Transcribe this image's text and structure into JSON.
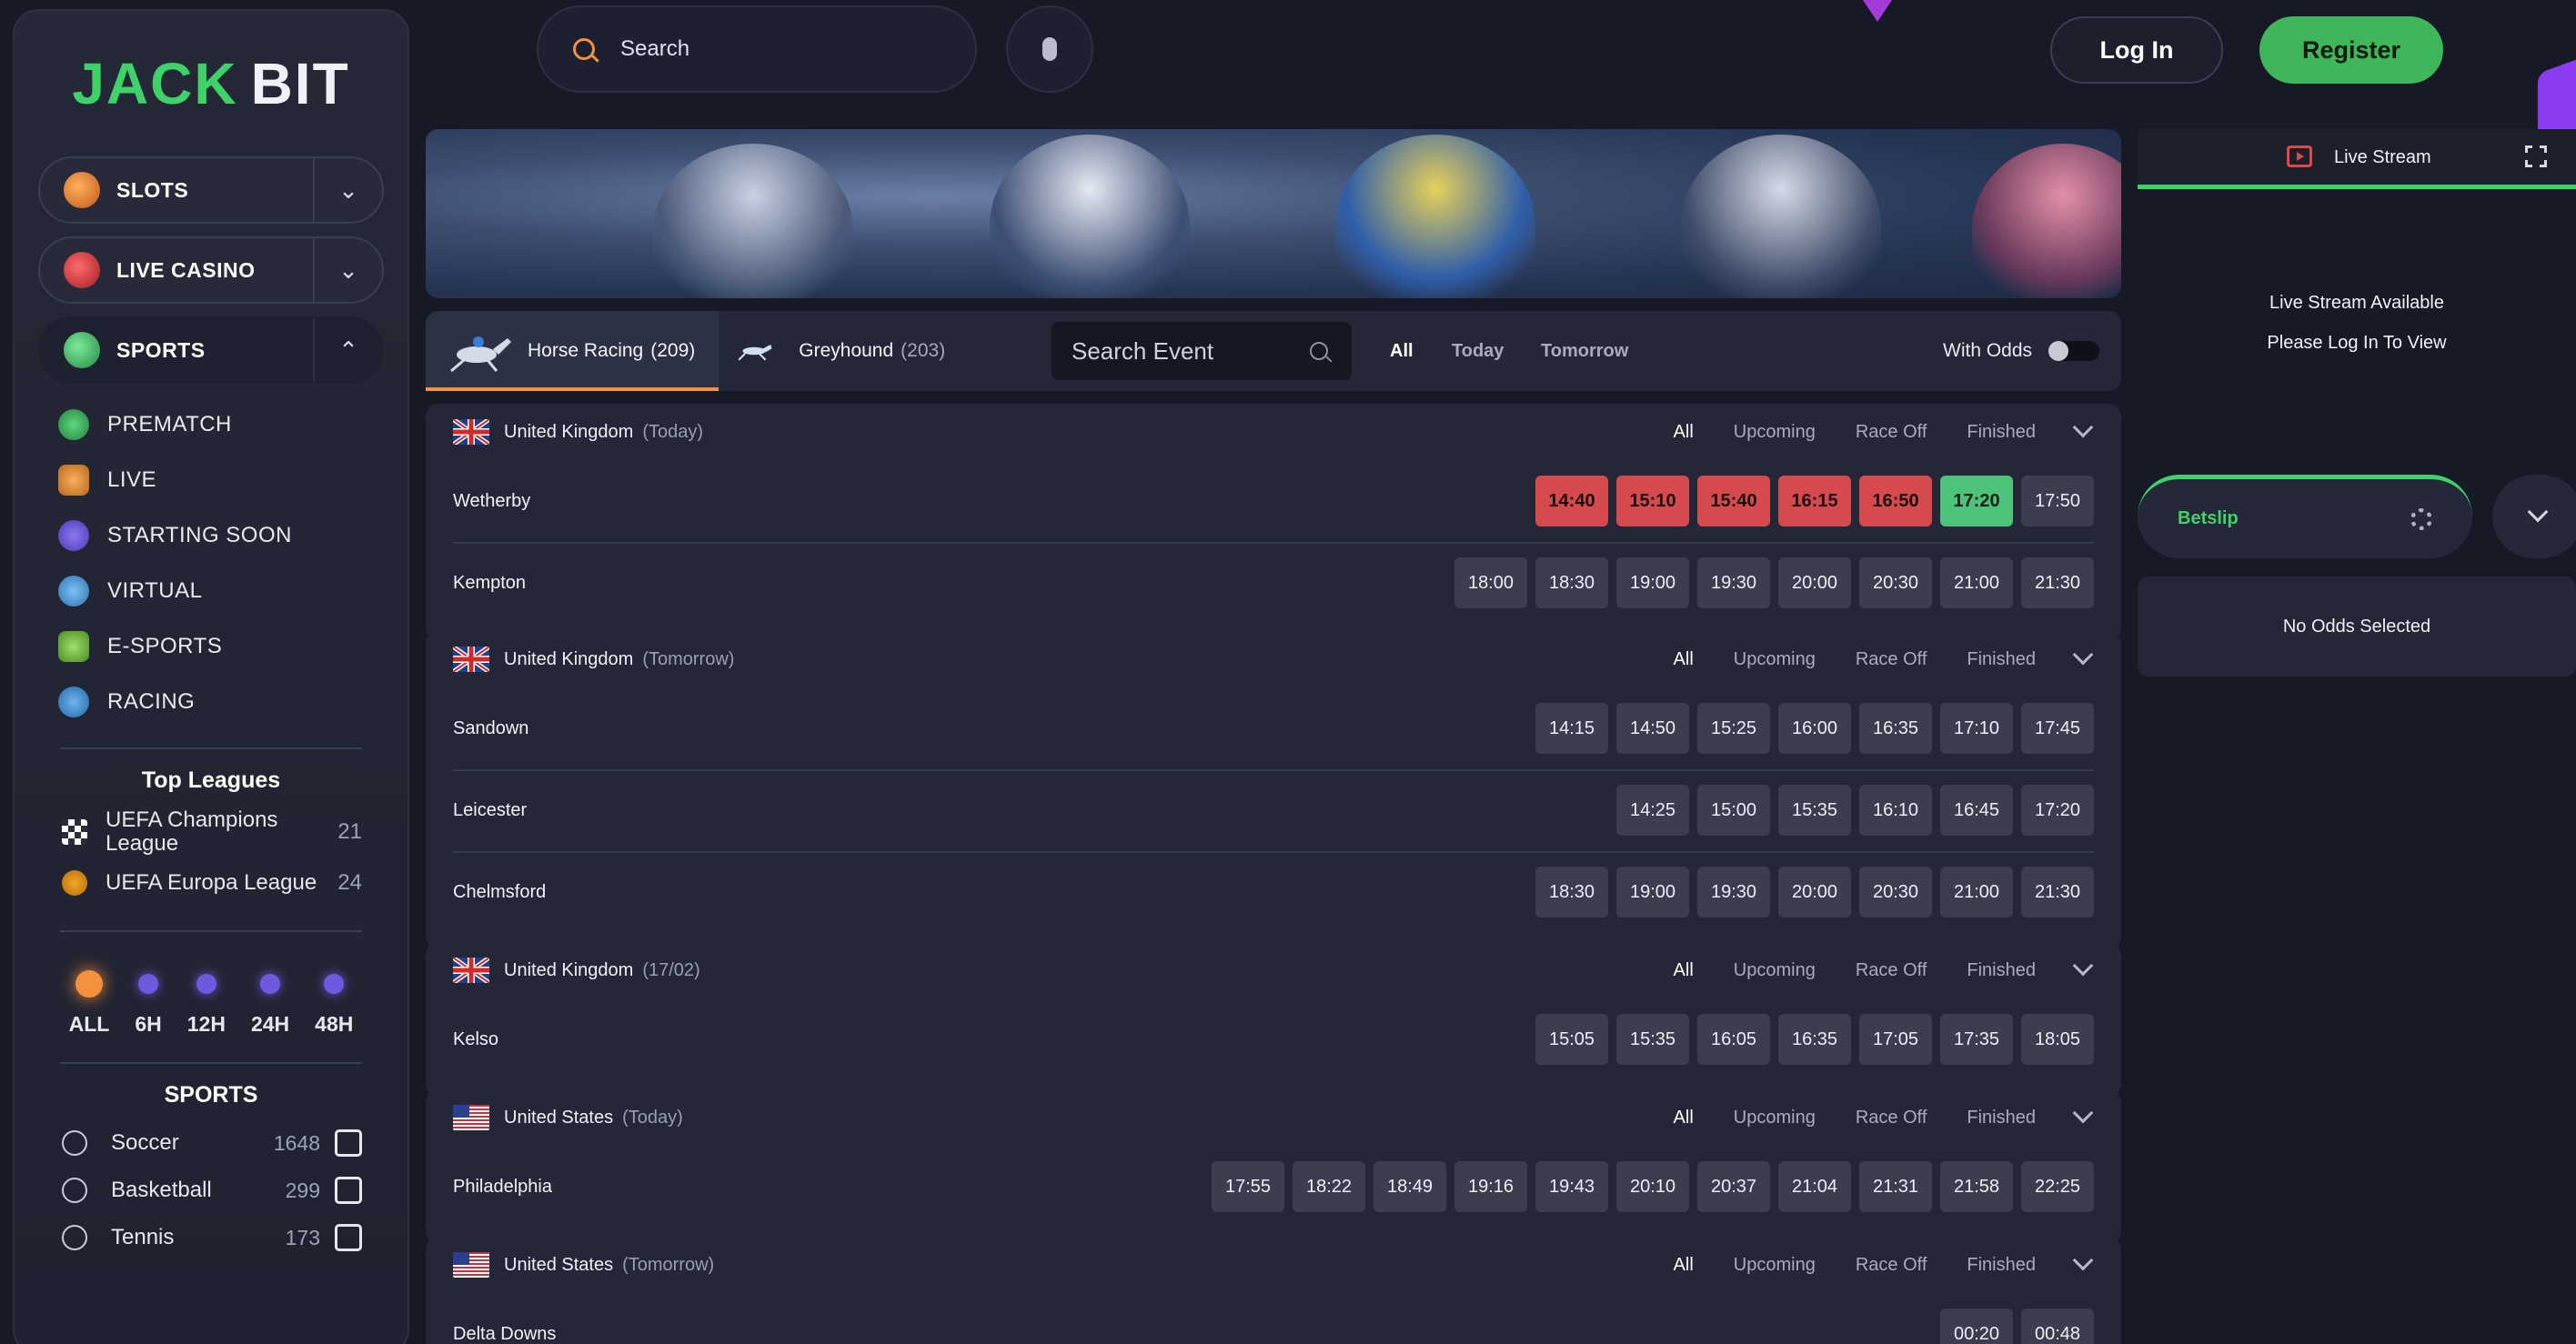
{
  "brand": {
    "part1": "JACK",
    "part2": "BIT"
  },
  "sidebar": {
    "menus": [
      {
        "label": "SLOTS",
        "icon": "slots-icon",
        "expanded": false
      },
      {
        "label": "LIVE CASINO",
        "icon": "live-casino-icon",
        "expanded": false
      },
      {
        "label": "SPORTS",
        "icon": "sports-icon",
        "expanded": true
      }
    ],
    "sub_items": [
      {
        "label": "PREMATCH",
        "icon": "prematch-icon"
      },
      {
        "label": "LIVE",
        "icon": "live-icon"
      },
      {
        "label": "STARTING SOON",
        "icon": "clock-icon"
      },
      {
        "label": "VIRTUAL",
        "icon": "virtual-icon"
      },
      {
        "label": "E-SPORTS",
        "icon": "esports-icon"
      },
      {
        "label": "RACING",
        "icon": "racing-icon"
      }
    ],
    "top_leagues_title": "Top Leagues",
    "leagues": [
      {
        "name": "UEFA Champions League",
        "count": "21"
      },
      {
        "name": "UEFA Europa League",
        "count": "24"
      }
    ],
    "time_filters": [
      "ALL",
      "6H",
      "12H",
      "24H",
      "48H"
    ],
    "sports_title": "SPORTS",
    "sports": [
      {
        "name": "Soccer",
        "count": "1648"
      },
      {
        "name": "Basketball",
        "count": "299"
      },
      {
        "name": "Tennis",
        "count": "173"
      }
    ]
  },
  "header": {
    "search_placeholder": "Search",
    "login": "Log In",
    "register": "Register"
  },
  "tabs": {
    "horse": {
      "name": "Horse Racing",
      "count": "(209)"
    },
    "greyhound": {
      "name": "Greyhound",
      "count": "(203)"
    },
    "search_placeholder": "Search Event",
    "days": [
      "All",
      "Today",
      "Tomorrow"
    ],
    "with_odds": "With Odds"
  },
  "filters": [
    "All",
    "Upcoming",
    "Race Off",
    "Finished"
  ],
  "blocks": [
    {
      "country": "United Kingdom",
      "qualifier": "(Today)",
      "flag": "uk",
      "races": [
        {
          "venue": "Wetherby",
          "times": [
            {
              "t": "14:40",
              "s": "red"
            },
            {
              "t": "15:10",
              "s": "red"
            },
            {
              "t": "15:40",
              "s": "red"
            },
            {
              "t": "16:15",
              "s": "red"
            },
            {
              "t": "16:50",
              "s": "red"
            },
            {
              "t": "17:20",
              "s": "green"
            },
            {
              "t": "17:50",
              "s": ""
            }
          ]
        },
        {
          "venue": "Kempton",
          "times": [
            {
              "t": "18:00",
              "s": ""
            },
            {
              "t": "18:30",
              "s": ""
            },
            {
              "t": "19:00",
              "s": ""
            },
            {
              "t": "19:30",
              "s": ""
            },
            {
              "t": "20:00",
              "s": ""
            },
            {
              "t": "20:30",
              "s": ""
            },
            {
              "t": "21:00",
              "s": ""
            },
            {
              "t": "21:30",
              "s": ""
            }
          ]
        }
      ]
    },
    {
      "country": "United Kingdom",
      "qualifier": "(Tomorrow)",
      "flag": "uk",
      "races": [
        {
          "venue": "Sandown",
          "times": [
            {
              "t": "14:15",
              "s": ""
            },
            {
              "t": "14:50",
              "s": ""
            },
            {
              "t": "15:25",
              "s": ""
            },
            {
              "t": "16:00",
              "s": ""
            },
            {
              "t": "16:35",
              "s": ""
            },
            {
              "t": "17:10",
              "s": ""
            },
            {
              "t": "17:45",
              "s": ""
            }
          ]
        },
        {
          "venue": "Leicester",
          "times": [
            {
              "t": "14:25",
              "s": ""
            },
            {
              "t": "15:00",
              "s": ""
            },
            {
              "t": "15:35",
              "s": ""
            },
            {
              "t": "16:10",
              "s": ""
            },
            {
              "t": "16:45",
              "s": ""
            },
            {
              "t": "17:20",
              "s": ""
            }
          ]
        },
        {
          "venue": "Chelmsford",
          "times": [
            {
              "t": "18:30",
              "s": ""
            },
            {
              "t": "19:00",
              "s": ""
            },
            {
              "t": "19:30",
              "s": ""
            },
            {
              "t": "20:00",
              "s": ""
            },
            {
              "t": "20:30",
              "s": ""
            },
            {
              "t": "21:00",
              "s": ""
            },
            {
              "t": "21:30",
              "s": ""
            }
          ]
        }
      ]
    },
    {
      "country": "United Kingdom",
      "qualifier": "(17/02)",
      "flag": "uk",
      "races": [
        {
          "venue": "Kelso",
          "times": [
            {
              "t": "15:05",
              "s": ""
            },
            {
              "t": "15:35",
              "s": ""
            },
            {
              "t": "16:05",
              "s": ""
            },
            {
              "t": "16:35",
              "s": ""
            },
            {
              "t": "17:05",
              "s": ""
            },
            {
              "t": "17:35",
              "s": ""
            },
            {
              "t": "18:05",
              "s": ""
            }
          ]
        }
      ]
    },
    {
      "country": "United States",
      "qualifier": "(Today)",
      "flag": "us",
      "races": [
        {
          "venue": "Philadelphia",
          "times": [
            {
              "t": "17:55",
              "s": ""
            },
            {
              "t": "18:22",
              "s": ""
            },
            {
              "t": "18:49",
              "s": ""
            },
            {
              "t": "19:16",
              "s": ""
            },
            {
              "t": "19:43",
              "s": ""
            },
            {
              "t": "20:10",
              "s": ""
            },
            {
              "t": "20:37",
              "s": ""
            },
            {
              "t": "21:04",
              "s": ""
            },
            {
              "t": "21:31",
              "s": ""
            },
            {
              "t": "21:58",
              "s": ""
            },
            {
              "t": "22:25",
              "s": ""
            }
          ]
        }
      ]
    },
    {
      "country": "United States",
      "qualifier": "(Tomorrow)",
      "flag": "us",
      "races": [
        {
          "venue": "Delta Downs",
          "times": [
            {
              "t": "00:20",
              "s": ""
            },
            {
              "t": "00:48",
              "s": ""
            }
          ]
        }
      ]
    }
  ],
  "right_panel": {
    "live_stream": "Live Stream",
    "msg1": "Live Stream Available",
    "msg2": "Please Log In To View",
    "betslip": "Betslip",
    "no_odds": "No Odds Selected"
  },
  "colors": {
    "accent_green": "#3fd26a",
    "accent_orange": "#f4913e",
    "race_off_red": "#d64a4e",
    "live_green": "#4cc27a"
  }
}
